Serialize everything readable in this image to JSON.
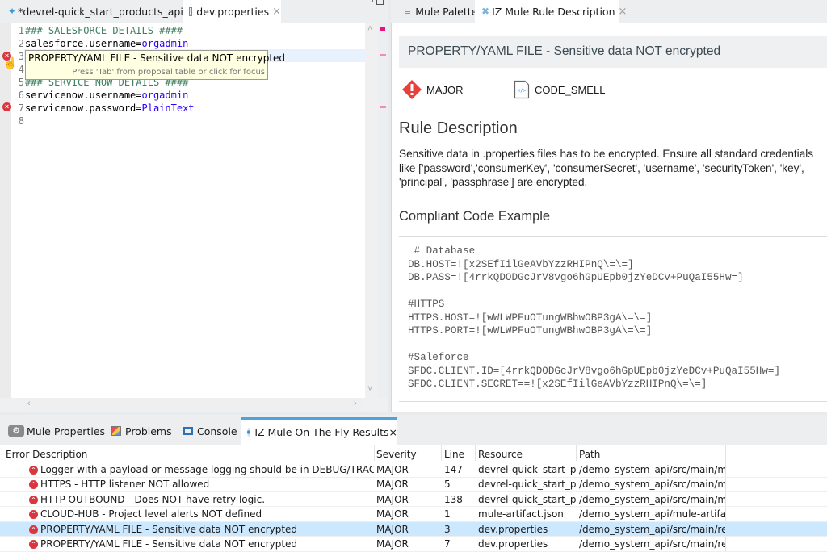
{
  "editor": {
    "tabs": [
      {
        "label": "*devrel-quick_start_products_api",
        "icon": "mule-flow-icon",
        "active": false
      },
      {
        "label": "dev.properties",
        "icon": "file-icon",
        "active": true,
        "close": "×"
      }
    ],
    "lines": [
      {
        "num": "1",
        "key": "### SALESFORCE DETAILS ####",
        "value": "",
        "comment": true
      },
      {
        "num": "2",
        "key": "salesforce.username=",
        "value": "orgadmin",
        "comment": false
      },
      {
        "num": "3",
        "key": "",
        "value": "",
        "comment": false,
        "error": true
      },
      {
        "num": "4",
        "key": "",
        "value": "",
        "comment": false
      },
      {
        "num": "5",
        "key": "### SERVICE NOW DETAILS ####",
        "value": "",
        "comment": true
      },
      {
        "num": "6",
        "key": "servicenow.username=",
        "value": "orgadmin",
        "comment": false
      },
      {
        "num": "7",
        "key": "servicenow.password=",
        "value": "PlainText",
        "comment": false,
        "error": true
      },
      {
        "num": "8",
        "key": "",
        "value": "",
        "comment": false
      }
    ],
    "tooltip": {
      "message": "PROPERTY/YAML FILE - Sensitive data NOT encrypted",
      "hint": "Press 'Tab' from proposal table or click for focus"
    }
  },
  "right_panel": {
    "tabs": [
      {
        "label": "Mule Palette",
        "icon": "palette-icon",
        "active": false
      },
      {
        "label": "IZ Mule Rule Description",
        "icon": "tools-icon",
        "active": true,
        "close": "×"
      }
    ],
    "rule_title": "PROPERTY/YAML FILE - Sensitive data NOT encrypted",
    "severity": {
      "label": "MAJOR",
      "icon": "major-severity-icon",
      "color": "#e8403a"
    },
    "type": {
      "label": "CODE_SMELL",
      "icon": "code-file-icon"
    },
    "description_heading": "Rule Description",
    "description_lines": [
      "Sensitive data in .properties files has to be encrypted. Ensure all standard credentials",
      "like ['password','consumerKey', 'consumerSecret', 'username', 'securityToken', 'key',",
      "'principal', 'passphrase'] are encrypted."
    ],
    "example_heading": "Compliant Code Example",
    "example_lines": [
      " # Database",
      "DB.HOST=![x2SEfIilGeAVbYzzRHIPnQ\\=\\=]",
      "DB.PASS=![4rrkQDODGcJrV8vgo6hGpUEpb0jzYeDCv+PuQaI55Hw=]",
      "",
      "#HTTPS",
      "HTTPS.HOST=![wWLWPFuOTungWBhwOBP3gA\\=\\=]",
      "HTTPS.PORT=![wWLWPFuOTungWBhwOBP3gA\\=\\=]",
      "",
      "#Saleforce",
      "SFDC.CLIENT.ID=[4rrkQDODGcJrV8vgo6hGpUEpb0jzYeDCv+PuQaI55Hw=]",
      "SFDC.CLIENT.SECRET==![x2SEfIilGeAVbYzzRHIPnQ\\=\\=]"
    ]
  },
  "bottom_panel": {
    "tabs": [
      {
        "label": "Mule Properties",
        "icon": "gear-icon",
        "active": false
      },
      {
        "label": "Problems",
        "icon": "problems-icon",
        "active": false
      },
      {
        "label": "Console",
        "icon": "console-icon",
        "active": false
      },
      {
        "label": "IZ Mule On The Fly Results",
        "icon": "results-icon",
        "active": true,
        "close": "×"
      }
    ],
    "columns": [
      "Error Description",
      "Severity",
      "Line",
      "Resource",
      "Path"
    ],
    "rows": [
      {
        "description": "Logger with a payload or message logging should be in DEBUG/TRACE level",
        "severity": "MAJOR",
        "line": "147",
        "resource": "devrel-quick_start_p...",
        "path": "/demo_system_api/src/main/m...",
        "selected": false
      },
      {
        "description": "HTTPS - HTTP listener NOT allowed",
        "severity": "MAJOR",
        "line": "5",
        "resource": "devrel-quick_start_p...",
        "path": "/demo_system_api/src/main/m...",
        "selected": false
      },
      {
        "description": "HTTP OUTBOUND - Does NOT have retry logic.",
        "severity": "MAJOR",
        "line": "138",
        "resource": "devrel-quick_start_p...",
        "path": "/demo_system_api/src/main/m...",
        "selected": false
      },
      {
        "description": "CLOUD-HUB - Project level alerts NOT defined",
        "severity": "MAJOR",
        "line": "1",
        "resource": "mule-artifact.json",
        "path": "/demo_system_api/mule-artifa...",
        "selected": false
      },
      {
        "description": "PROPERTY/YAML FILE - Sensitive data NOT encrypted",
        "severity": "MAJOR",
        "line": "3",
        "resource": "dev.properties",
        "path": "/demo_system_api/src/main/re...",
        "selected": true
      },
      {
        "description": "PROPERTY/YAML FILE - Sensitive data NOT encrypted",
        "severity": "MAJOR",
        "line": "7",
        "resource": "dev.properties",
        "path": "/demo_system_api/src/main/re...",
        "selected": false
      }
    ]
  }
}
